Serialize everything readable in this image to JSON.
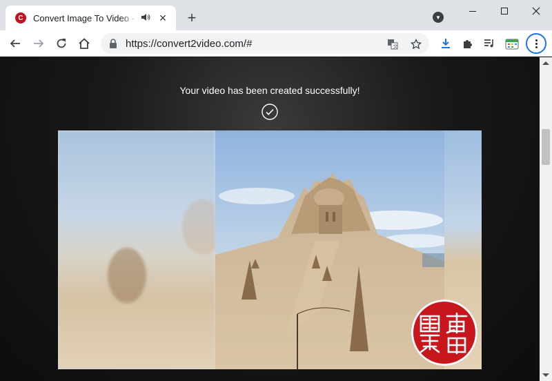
{
  "browser": {
    "tab": {
      "title": "Convert Image To Video - C",
      "favicon": "C",
      "audio_icon": "speaker-icon",
      "close_label": "✕"
    },
    "new_tab_label": "+",
    "address": {
      "url": "https://convert2video.com/#"
    }
  },
  "page": {
    "success_message": "Your video has been created successfully!",
    "check_icon": "check-circle-icon"
  },
  "colors": {
    "accent": "#1a73e8",
    "favicon_red": "#c1121f",
    "stamp_red": "#c8161d"
  }
}
